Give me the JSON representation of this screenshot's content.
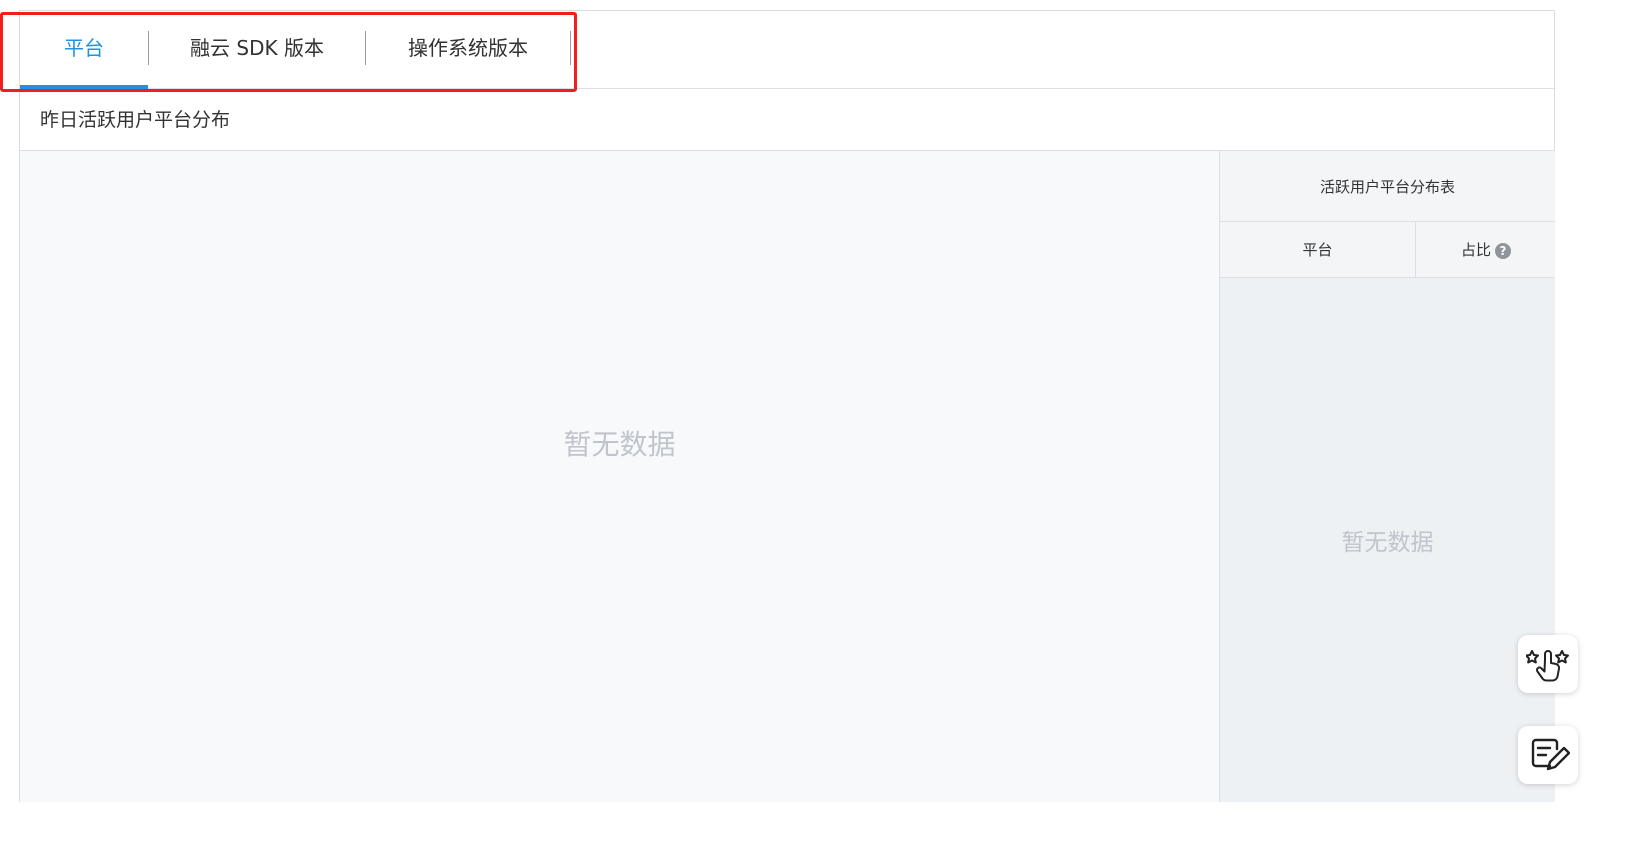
{
  "tabs": [
    {
      "label": "平台",
      "active": true
    },
    {
      "label": "融云 SDK 版本",
      "active": false
    },
    {
      "label": "操作系统版本",
      "active": false
    }
  ],
  "section": {
    "title": "昨日活跃用户平台分布"
  },
  "chart": {
    "empty_text": "暂无数据"
  },
  "table": {
    "title": "活跃用户平台分布表",
    "columns": {
      "platform": "平台",
      "ratio": "占比"
    },
    "help_icon": "?",
    "empty_text": "暂无数据"
  },
  "icons": {
    "rating": "rating-hand-icon",
    "feedback": "feedback-edit-icon"
  },
  "colors": {
    "accent": "#1e93e6",
    "highlight": "#f01e1e"
  }
}
